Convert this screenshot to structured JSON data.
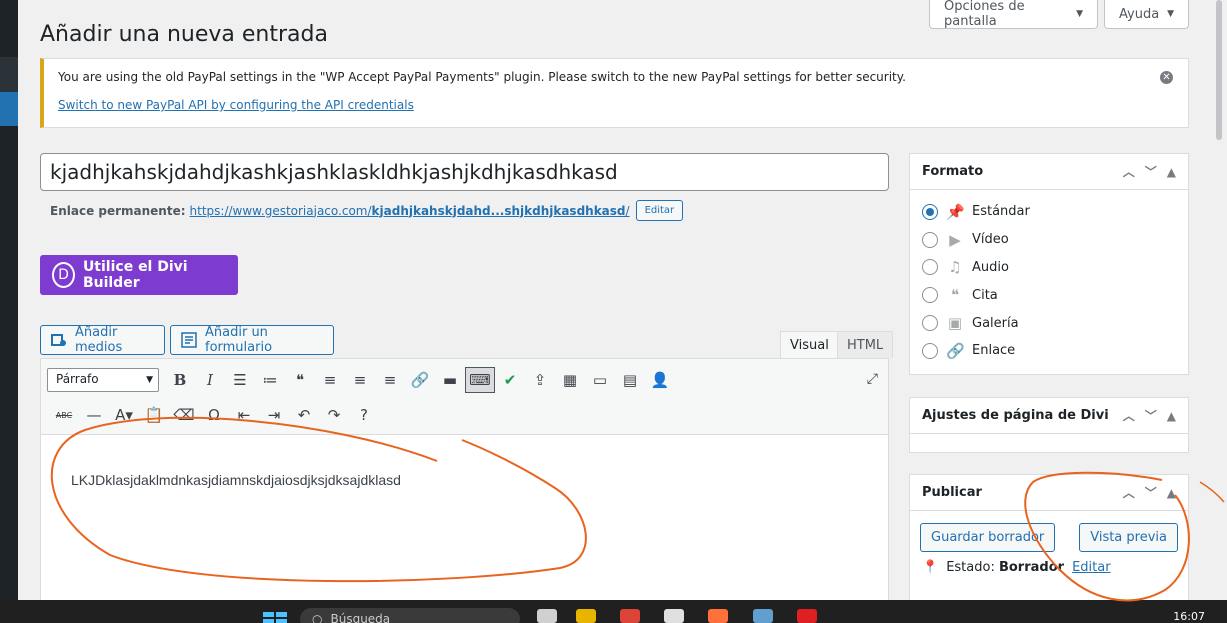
{
  "header": {
    "screen_options": "Opciones de pantalla",
    "help": "Ayuda",
    "page_title": "Añadir una nueva entrada"
  },
  "notice": {
    "message": "You are using the old PayPal settings in the \"WP Accept PayPal Payments\" plugin. Please switch to the new PayPal settings for better security.",
    "link": "Switch to new PayPal API by configuring the API credentials",
    "accent": "#dba617"
  },
  "post": {
    "title": "kjadhjkahskjdahdjkashkjashklaskldhkjashjkdhjkasdhkasd",
    "permalink_label": "Enlace permanente:",
    "permalink_base": "https://www.gestoriajaco.com/",
    "permalink_slug": "kjadhjkahskjdahd...shjkdhjkasdhkasd",
    "permalink_trailing": "/",
    "edit_permalink": "Editar"
  },
  "divi": {
    "logo": "D",
    "label": "Utilice el Divi Builder",
    "color": "#7e3bd0"
  },
  "media": {
    "add_media": "Añadir medios",
    "add_form": "Añadir un formulario"
  },
  "editor": {
    "tab_visual": "Visual",
    "tab_html": "HTML",
    "format_select": "Párrafo",
    "content": "LKJDklasjdaklmdnkasjdiamnskdjaiosdjksjdksajdklasd",
    "toolbar_row1": [
      {
        "name": "bold-icon",
        "glyph": "B"
      },
      {
        "name": "italic-icon",
        "glyph": "I"
      },
      {
        "name": "bullet-list-icon",
        "glyph": "☰"
      },
      {
        "name": "numbered-list-icon",
        "glyph": "≔"
      },
      {
        "name": "blockquote-icon",
        "glyph": "❝"
      },
      {
        "name": "align-left-icon",
        "glyph": "≡"
      },
      {
        "name": "align-center-icon",
        "glyph": "≡"
      },
      {
        "name": "align-right-icon",
        "glyph": "≡"
      },
      {
        "name": "link-icon",
        "glyph": "🔗"
      },
      {
        "name": "read-more-icon",
        "glyph": "▬"
      },
      {
        "name": "toolbar-toggle-icon",
        "glyph": "⌨"
      },
      {
        "name": "check-icon",
        "glyph": "✔"
      },
      {
        "name": "upload-icon",
        "glyph": "⇪"
      },
      {
        "name": "grid-icon",
        "glyph": "▦"
      },
      {
        "name": "layers-icon",
        "glyph": "▭"
      },
      {
        "name": "table-icon",
        "glyph": "▤"
      },
      {
        "name": "user-icon",
        "glyph": "👤"
      }
    ],
    "toolbar_row2": [
      {
        "name": "strikethrough-icon",
        "glyph": "ABC"
      },
      {
        "name": "horizontal-line-icon",
        "glyph": "—"
      },
      {
        "name": "text-color-icon",
        "glyph": "A▾"
      },
      {
        "name": "paste-text-icon",
        "glyph": "📋"
      },
      {
        "name": "clear-formatting-icon",
        "glyph": "⌫"
      },
      {
        "name": "special-char-icon",
        "glyph": "Ω"
      },
      {
        "name": "outdent-icon",
        "glyph": "⇤"
      },
      {
        "name": "indent-icon",
        "glyph": "⇥"
      },
      {
        "name": "undo-icon",
        "glyph": "↶"
      },
      {
        "name": "redo-icon",
        "glyph": "↷"
      },
      {
        "name": "help-icon",
        "glyph": "?"
      }
    ]
  },
  "sidebar": {
    "format_title": "Formato",
    "formats": [
      {
        "label": "Estándar",
        "icon": "pin-icon",
        "glyph": "📌",
        "checked": true
      },
      {
        "label": "Vídeo",
        "icon": "video-icon",
        "glyph": "▶",
        "checked": false
      },
      {
        "label": "Audio",
        "icon": "audio-icon",
        "glyph": "♫",
        "checked": false
      },
      {
        "label": "Cita",
        "icon": "quote-icon",
        "glyph": "❝",
        "checked": false
      },
      {
        "label": "Galería",
        "icon": "gallery-icon",
        "glyph": "▣",
        "checked": false
      },
      {
        "label": "Enlace",
        "icon": "link-icon",
        "glyph": "🔗",
        "checked": false
      }
    ],
    "divi_settings_title": "Ajustes de página de Divi",
    "publish_title": "Publicar",
    "save_draft": "Guardar borrador",
    "preview": "Vista previa",
    "status_label": "Estado:",
    "status_value": "Borrador",
    "status_edit": "Editar"
  },
  "taskbar": {
    "search": "Búsqueda",
    "time": "16:07"
  },
  "annotation_color": "#e8641e"
}
